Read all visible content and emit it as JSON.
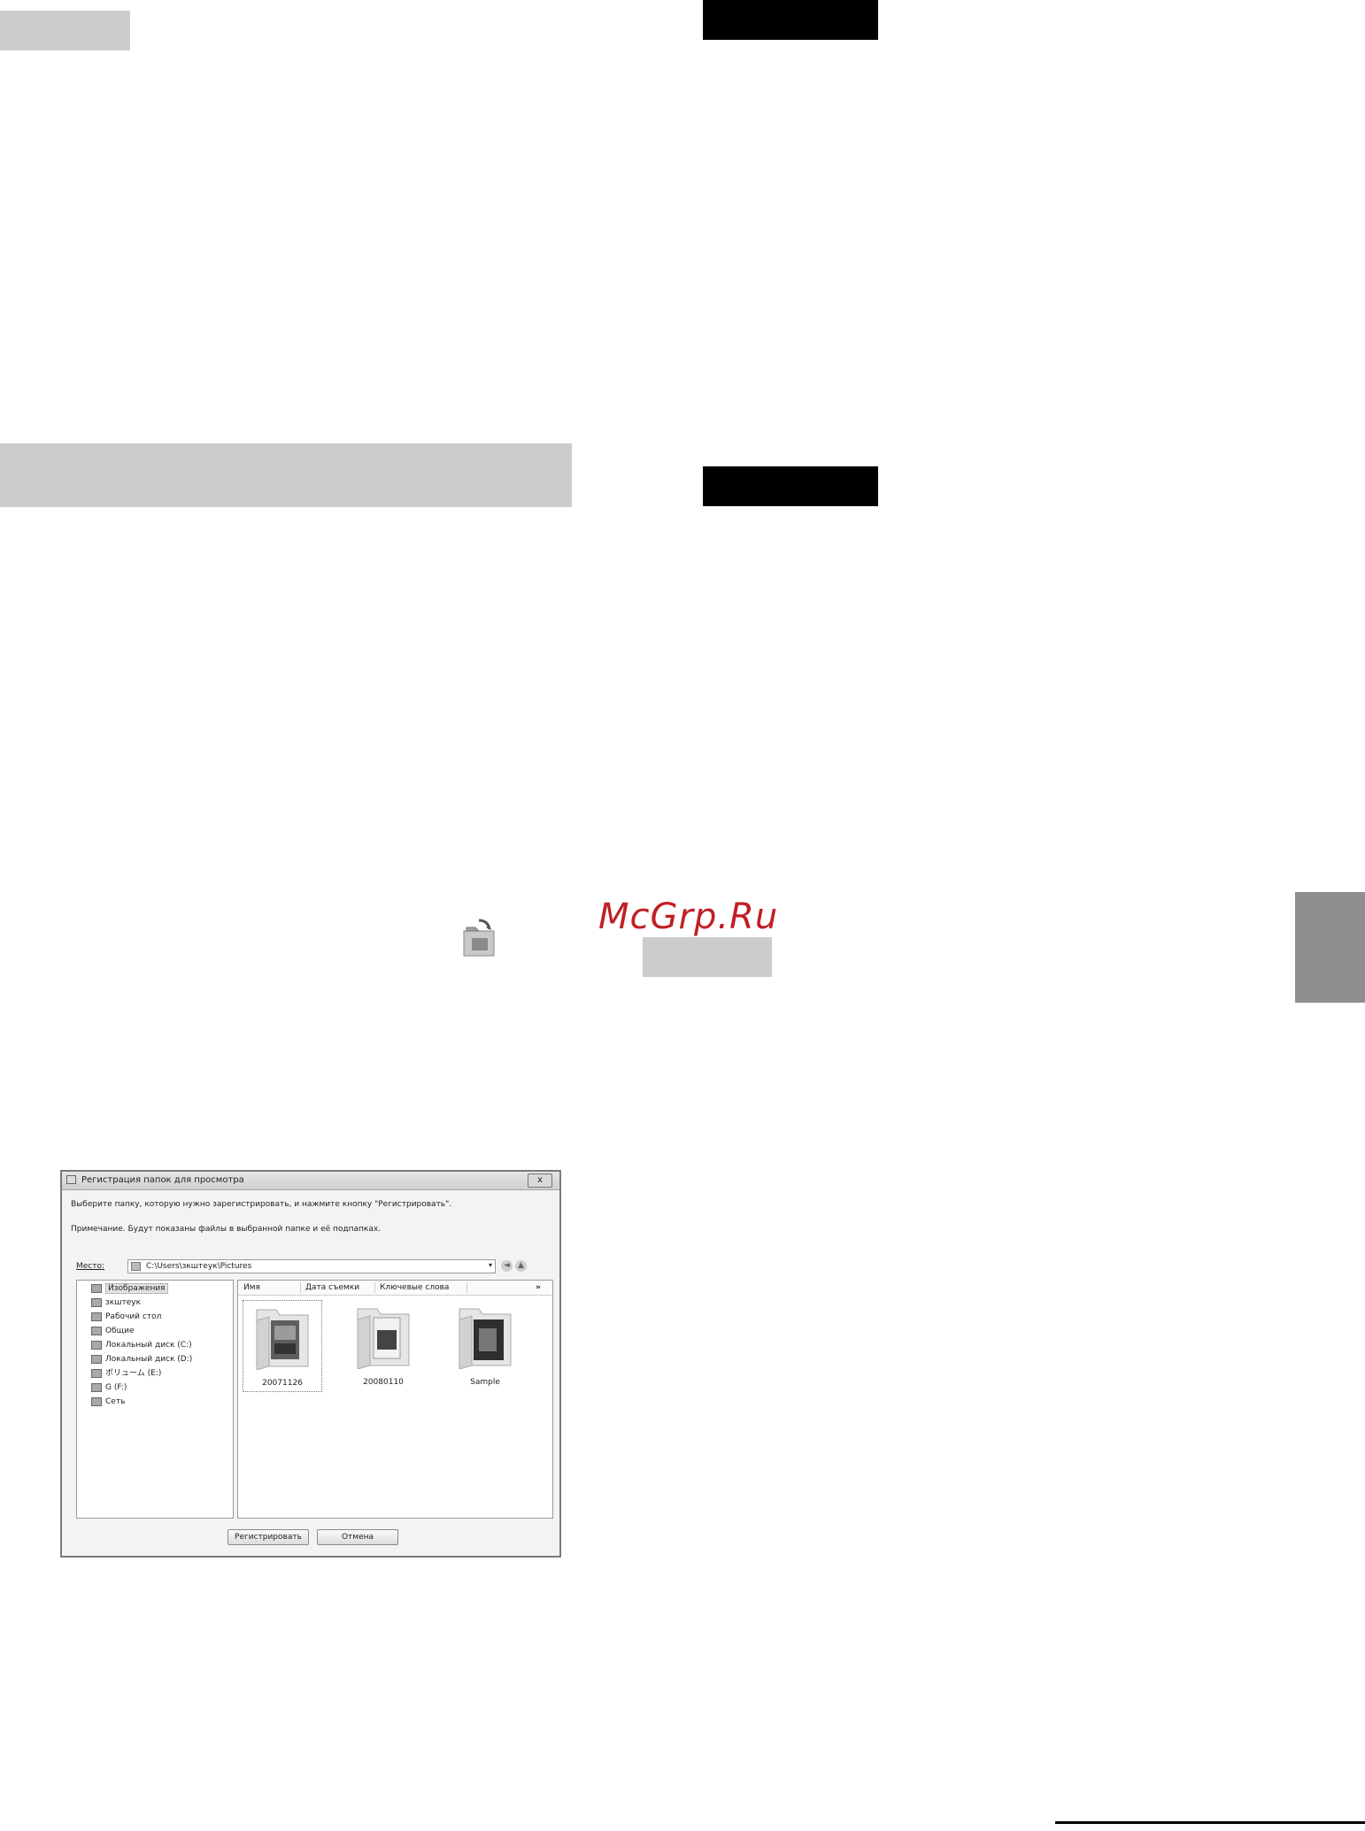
{
  "watermark": "McGrp.Ru",
  "dialog": {
    "title": "Регистрация папок для просмотра",
    "close_label": "x",
    "instruction": "Выберите папку, которую нужно зарегистрировать, и нажмите кнопку \"Регистрировать\".",
    "note": "Примечание. Будут показаны файлы в выбранной папке и её подпапках.",
    "location_label": "Место:",
    "location_value": "C:\\Users\\зкштеук\\Pictures",
    "back_icon": "back-arrow-icon",
    "up_icon": "up-folder-icon",
    "tree_items": [
      {
        "label": "Изображения",
        "icon": "pictures-folder-icon",
        "selected": true
      },
      {
        "label": "зкштеук",
        "icon": "user-folder-icon"
      },
      {
        "label": "Рабочий стол",
        "icon": "desktop-icon"
      },
      {
        "label": "Общие",
        "icon": "shared-folder-icon"
      },
      {
        "label": "Локальный диск (C:)",
        "icon": "hard-drive-icon"
      },
      {
        "label": "Локальный диск (D:)",
        "icon": "hard-drive-icon"
      },
      {
        "label": "ボリューム (E:)",
        "icon": "drive-icon"
      },
      {
        "label": "G (F:)",
        "icon": "drive-icon"
      },
      {
        "label": "Сеть",
        "icon": "network-icon"
      }
    ],
    "columns": [
      "Имя",
      "Дата съемки",
      "Ключевые слова",
      "»"
    ],
    "folders": [
      {
        "name": "20071126",
        "selected": true
      },
      {
        "name": "20080110"
      },
      {
        "name": "Sample"
      }
    ],
    "register_button": "Регистрировать",
    "cancel_button": "Отмена"
  },
  "colors": {
    "watermark": "#c01f24",
    "gray_block": "#cccccc",
    "side_tab": "#8f8f8f",
    "black_block": "#000000"
  },
  "icons": {
    "register_folder": "register-folder-icon"
  }
}
